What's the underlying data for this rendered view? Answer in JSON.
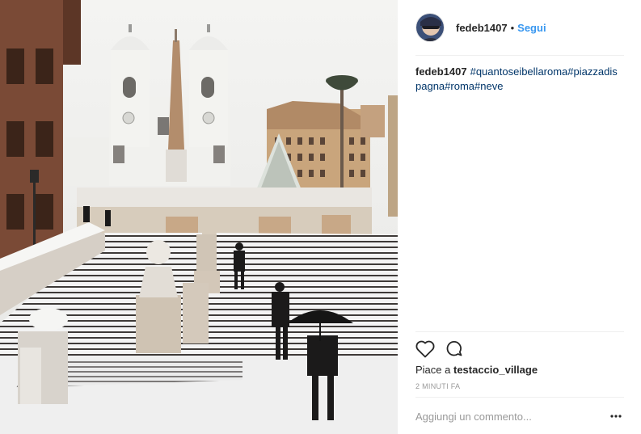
{
  "post": {
    "photo_alt": "",
    "author": {
      "username": "fedeb1407",
      "separator": "•",
      "follow_label": "Segui"
    },
    "caption": {
      "username": "fedeb1407",
      "hashtags": [
        "#quantoseibellaroma",
        "#piazzadispagna",
        "#roma",
        "#neve"
      ]
    },
    "actions": {
      "like_icon": "heart-icon",
      "comment_icon": "comment-icon"
    },
    "likes": {
      "prefix": "Piace a",
      "liker": "testaccio_village"
    },
    "timestamp": "2 MINUTI FA",
    "comment_box": {
      "placeholder": "Aggiungi un commento...",
      "more_icon": "more-options-icon"
    }
  },
  "colors": {
    "link_blue": "#3897f0",
    "hashtag_blue": "#003569",
    "muted_gray": "#999999",
    "divider": "#efefef"
  }
}
